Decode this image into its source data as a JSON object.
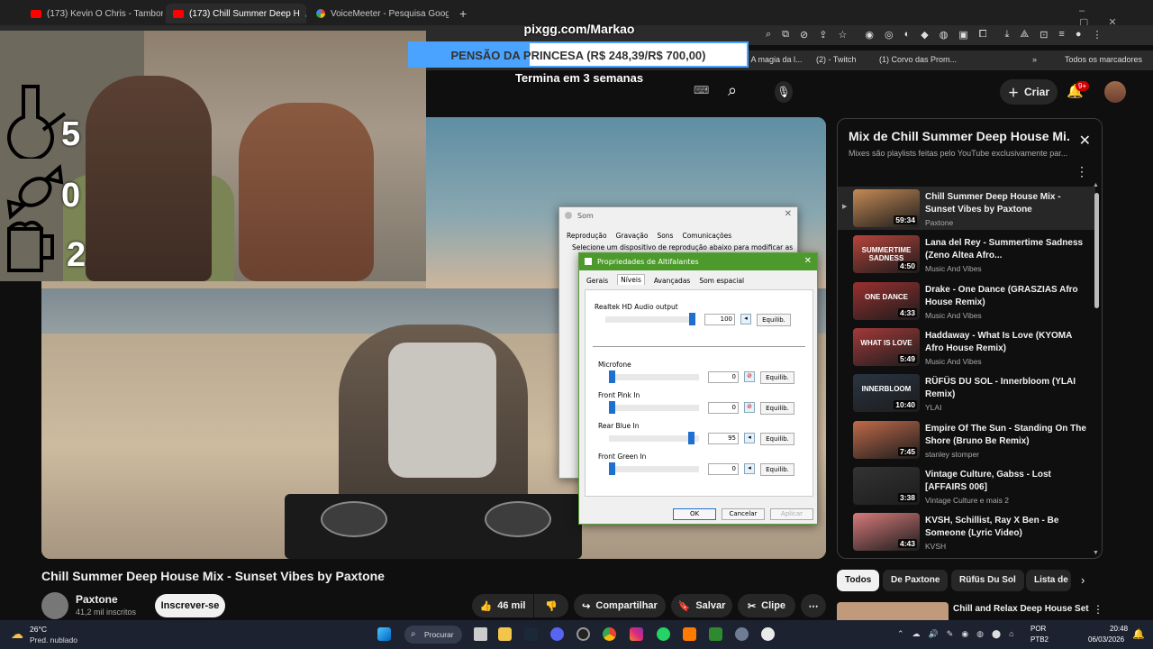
{
  "browser": {
    "tabs": [
      {
        "title": "(173) Kevin O Chris - Tamborzã",
        "active": false
      },
      {
        "title": "(173) Chill Summer Deep H",
        "active": true
      },
      {
        "title": "VoiceMeeter - Pesquisa Google",
        "active": false
      }
    ],
    "bookmarks": [
      "r: A magia da l...",
      "(2) - Twitch",
      "(1) Corvo das Prom...",
      "Todos os marcadores"
    ],
    "new_tab_label": "+"
  },
  "stream_overlay": {
    "pix_url": "pixgg.com/Markao",
    "goal_text": "PENSÃO DA PRINCESA (R$ 248,39/R$ 700,00)",
    "goal_progress": 0.355,
    "ends_text": "Termina em 3 semanas",
    "counters": [
      {
        "icon": "bong-icon",
        "value": "5"
      },
      {
        "icon": "candy-icon",
        "value": "0"
      },
      {
        "icon": "beer-mug-icon",
        "value": "2"
      }
    ]
  },
  "youtube": {
    "create_label": "Criar",
    "notification_count": "9+",
    "video_title": "Chill Summer Deep House Mix - Sunset Vibes by Paxtone",
    "channel_name": "Paxtone",
    "channel_subs": "41,2 mil inscritos",
    "subscribe_label": "Inscrever-se",
    "likes": "46 mil",
    "share_label": "Compartilhar",
    "save_label": "Salvar",
    "clip_label": "Clipe",
    "chips": [
      "Todos",
      "De Paxtone",
      "Rüfüs Du Sol",
      "Lista de"
    ],
    "next_video_title": "Chill and Relax Deep House Set",
    "playlist": {
      "title": "Mix de Chill Summer Deep House Mi...",
      "subtitle": "Mixes são playlists feitas pelo YouTube exclusivamente par...",
      "items": [
        {
          "title": "Chill Summer Deep House Mix - Sunset Vibes by Paxtone",
          "channel": "Paxtone",
          "duration": "59:34",
          "selected": true,
          "thumb": "#c58a55",
          "thumb_text": ""
        },
        {
          "title": "Lana del Rey - Summertime Sadness (Zeno Altea Afro...",
          "channel": "Music And Vibes",
          "duration": "4:50",
          "selected": false,
          "thumb": "#b6443b",
          "thumb_text": "SUMMERTIME SADNESS"
        },
        {
          "title": "Drake - One Dance (GRASZIAS Afro House Remix)",
          "channel": "Music And Vibes",
          "duration": "4:33",
          "selected": false,
          "thumb": "#9a3030",
          "thumb_text": "ONE DANCE"
        },
        {
          "title": "Haddaway - What Is Love (KYOMA Afro House Remix)",
          "channel": "Music And Vibes",
          "duration": "5:49",
          "selected": false,
          "thumb": "#a33a3a",
          "thumb_text": "WHAT IS LOVE"
        },
        {
          "title": "RÜFÜS DU SOL - Innerbloom (YLAI Remix)",
          "channel": "YLAI",
          "duration": "10:40",
          "selected": false,
          "thumb": "#2a3442",
          "thumb_text": "INNERBLOOM"
        },
        {
          "title": "Empire Of The Sun - Standing On The Shore (Bruno Be Remix)",
          "channel": "stanley stomper",
          "duration": "7:45",
          "selected": false,
          "thumb": "#c06a4a",
          "thumb_text": ""
        },
        {
          "title": "Vintage Culture, Gabss - Lost [AFFAIRS 006]",
          "channel": "Vintage Culture e mais 2",
          "duration": "3:38",
          "selected": false,
          "thumb": "#333333",
          "thumb_text": ""
        },
        {
          "title": "KVSH, Schillist, Ray X Ben - Be Someone (Lyric Video)",
          "channel": "KVSH",
          "duration": "4:43",
          "selected": false,
          "thumb": "#d77a7a",
          "thumb_text": ""
        }
      ]
    }
  },
  "sound_dialog": {
    "title": "Som",
    "tabs": [
      "Reprodução",
      "Gravação",
      "Sons",
      "Comunicações"
    ],
    "hint": "Selecione um dispositivo de reprodução abaixo para modificar as"
  },
  "speaker_props": {
    "title": "Propriedades de Altifalantes",
    "tabs": [
      "Gerais",
      "Níveis",
      "Avançadas",
      "Som espacial"
    ],
    "devices": [
      {
        "name": "Realtek HD Audio output",
        "value": "100",
        "level": 1.0,
        "muted": false
      },
      {
        "name": "Microfone",
        "value": "0",
        "level": 0.0,
        "muted": true
      },
      {
        "name": "Front Pink In",
        "value": "0",
        "level": 0.0,
        "muted": true
      },
      {
        "name": "Rear Blue In",
        "value": "95",
        "level": 0.95,
        "muted": false
      },
      {
        "name": "Front Green In",
        "value": "0",
        "level": 0.0,
        "muted": false
      }
    ],
    "balance_label": "Equilib.",
    "ok_label": "OK",
    "cancel_label": "Cancelar",
    "apply_label": "Aplicar"
  },
  "taskbar": {
    "weather_temp": "26°C",
    "weather_desc": "Pred. nublado",
    "search_label": "Procurar",
    "lang": "POR",
    "kbd": "PTB2",
    "time": "20:48",
    "date": "06/03/2026"
  },
  "colors": {
    "yt_red": "#ff0000",
    "accent_blue": "#4aa3ff",
    "dialog_green": "#4b9a2b"
  }
}
